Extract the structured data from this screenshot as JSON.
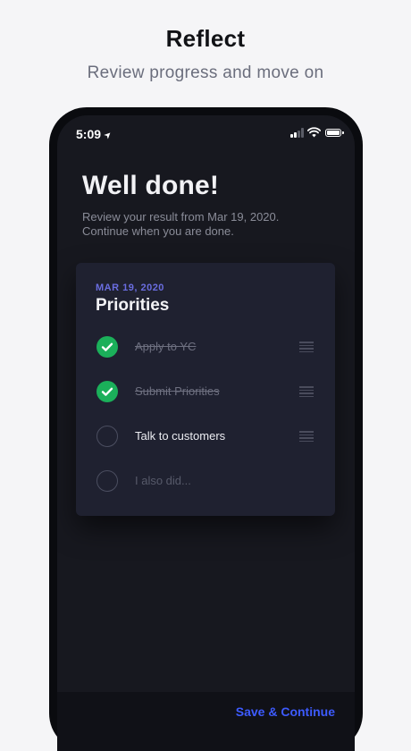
{
  "promo": {
    "title": "Reflect",
    "subtitle": "Review progress and move on"
  },
  "status_bar": {
    "time": "5:09",
    "icons": [
      "location-arrow-icon",
      "cellular-signal-icon",
      "wifi-icon",
      "battery-icon"
    ]
  },
  "screen": {
    "headline": "Well done!",
    "intro_line1": "Review your result from Mar 19, 2020.",
    "intro_line2": "Continue when you are done."
  },
  "card": {
    "date": "MAR 19, 2020",
    "title": "Priorities",
    "tasks": [
      {
        "label": "Apply to YC",
        "done": true
      },
      {
        "label": "Submit Priorities",
        "done": true
      },
      {
        "label": "Talk to customers",
        "done": false
      }
    ],
    "new_task_placeholder": "I also did..."
  },
  "footer": {
    "save_label": "Save & Continue"
  },
  "colors": {
    "accent": "#3d5bff",
    "date_accent": "#6a6de0",
    "done_green": "#1bb05a",
    "screen_bg": "#17181f",
    "card_bg": "#1f2130"
  }
}
